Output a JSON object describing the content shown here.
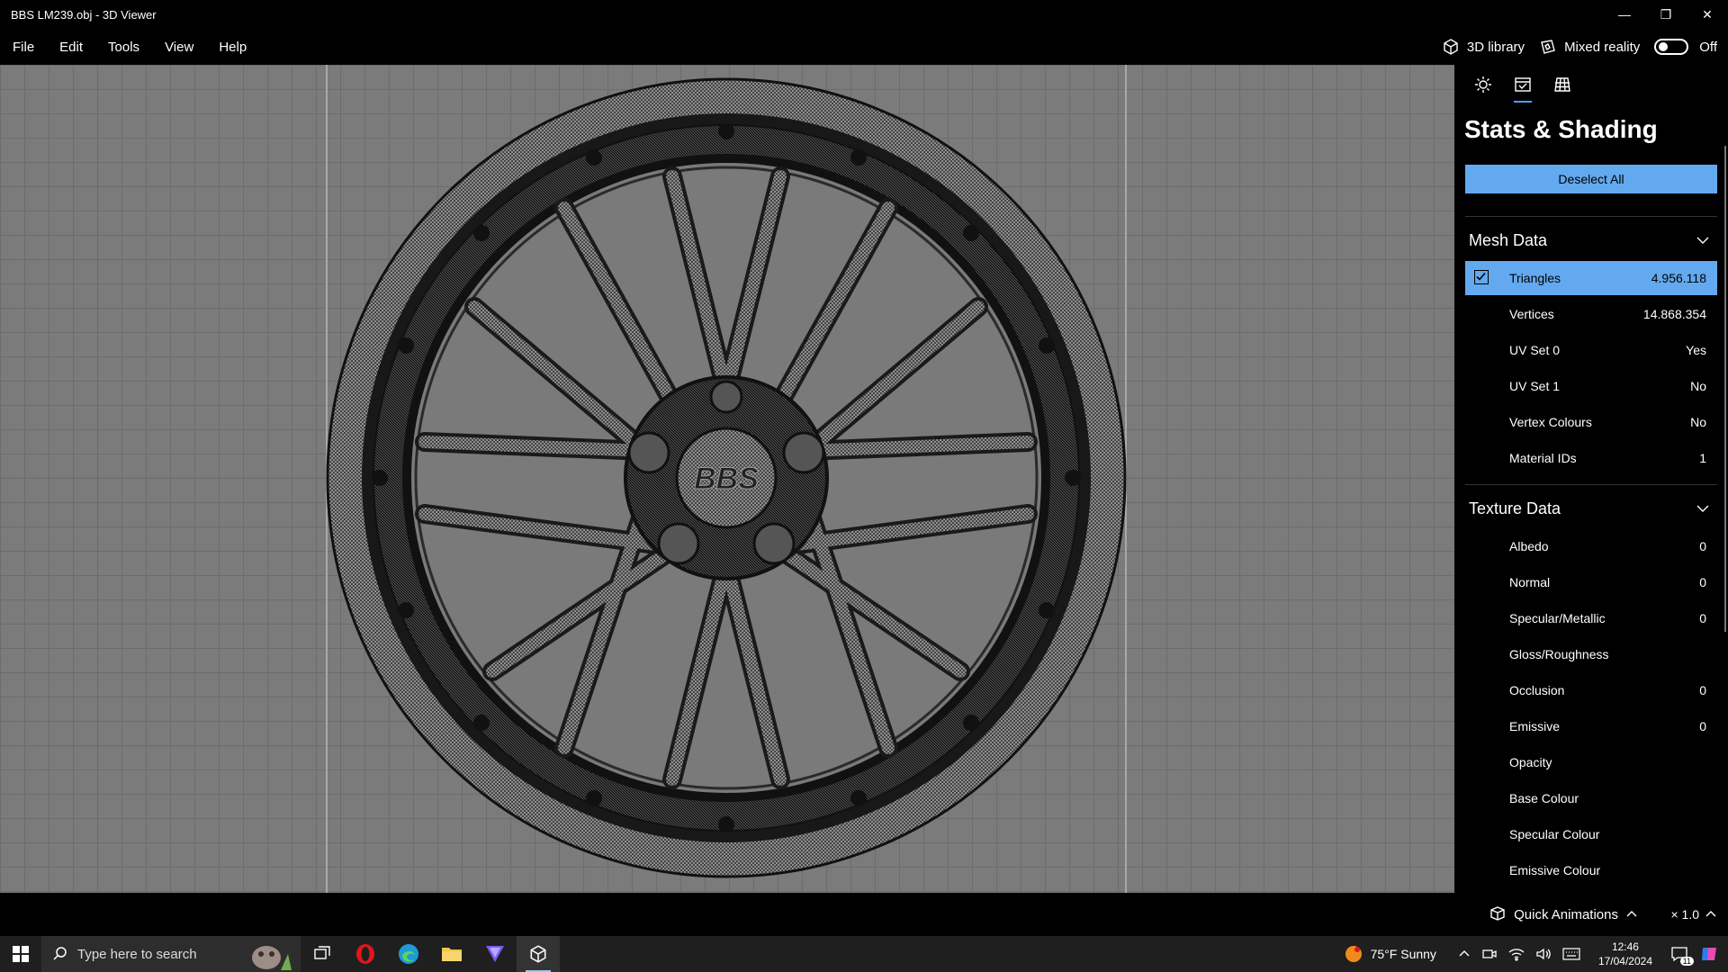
{
  "window": {
    "title": "BBS LM239.obj - 3D Viewer",
    "minimize": "—",
    "restore": "❐",
    "close": "✕"
  },
  "menu": {
    "items": [
      "File",
      "Edit",
      "Tools",
      "View",
      "Help"
    ],
    "library_label": "3D library",
    "mixed_reality_label": "Mixed reality",
    "mixed_reality_state": "Off"
  },
  "panel": {
    "title": "Stats & Shading",
    "deselect_label": "Deselect All",
    "mesh_section": "Mesh Data",
    "mesh_rows": [
      {
        "label": "Triangles",
        "value": "4.956.118",
        "selected": true
      },
      {
        "label": "Vertices",
        "value": "14.868.354"
      },
      {
        "label": "UV Set 0",
        "value": "Yes"
      },
      {
        "label": "UV Set 1",
        "value": "No"
      },
      {
        "label": "Vertex Colours",
        "value": "No"
      },
      {
        "label": "Material IDs",
        "value": "1"
      }
    ],
    "texture_section": "Texture Data",
    "texture_rows": [
      {
        "label": "Albedo",
        "value": "0"
      },
      {
        "label": "Normal",
        "value": "0"
      },
      {
        "label": "Specular/Metallic",
        "value": "0"
      },
      {
        "label": "Gloss/Roughness",
        "value": ""
      },
      {
        "label": "Occlusion",
        "value": "0"
      },
      {
        "label": "Emissive",
        "value": "0"
      },
      {
        "label": "Opacity",
        "value": ""
      },
      {
        "label": "Base Colour",
        "value": ""
      },
      {
        "label": "Specular Colour",
        "value": ""
      },
      {
        "label": "Emissive Colour",
        "value": ""
      }
    ]
  },
  "model": {
    "logo_text": "BBS"
  },
  "status": {
    "quick_animations": "Quick Animations",
    "zoom": "× 1.0"
  },
  "taskbar": {
    "search_placeholder": "Type here to search",
    "weather": "75°F  Sunny",
    "time": "12:46",
    "date": "17/04/2024",
    "notification_count": "11"
  },
  "colors": {
    "accent": "#63a9ef",
    "viewport_bg": "#7b7b7b"
  }
}
